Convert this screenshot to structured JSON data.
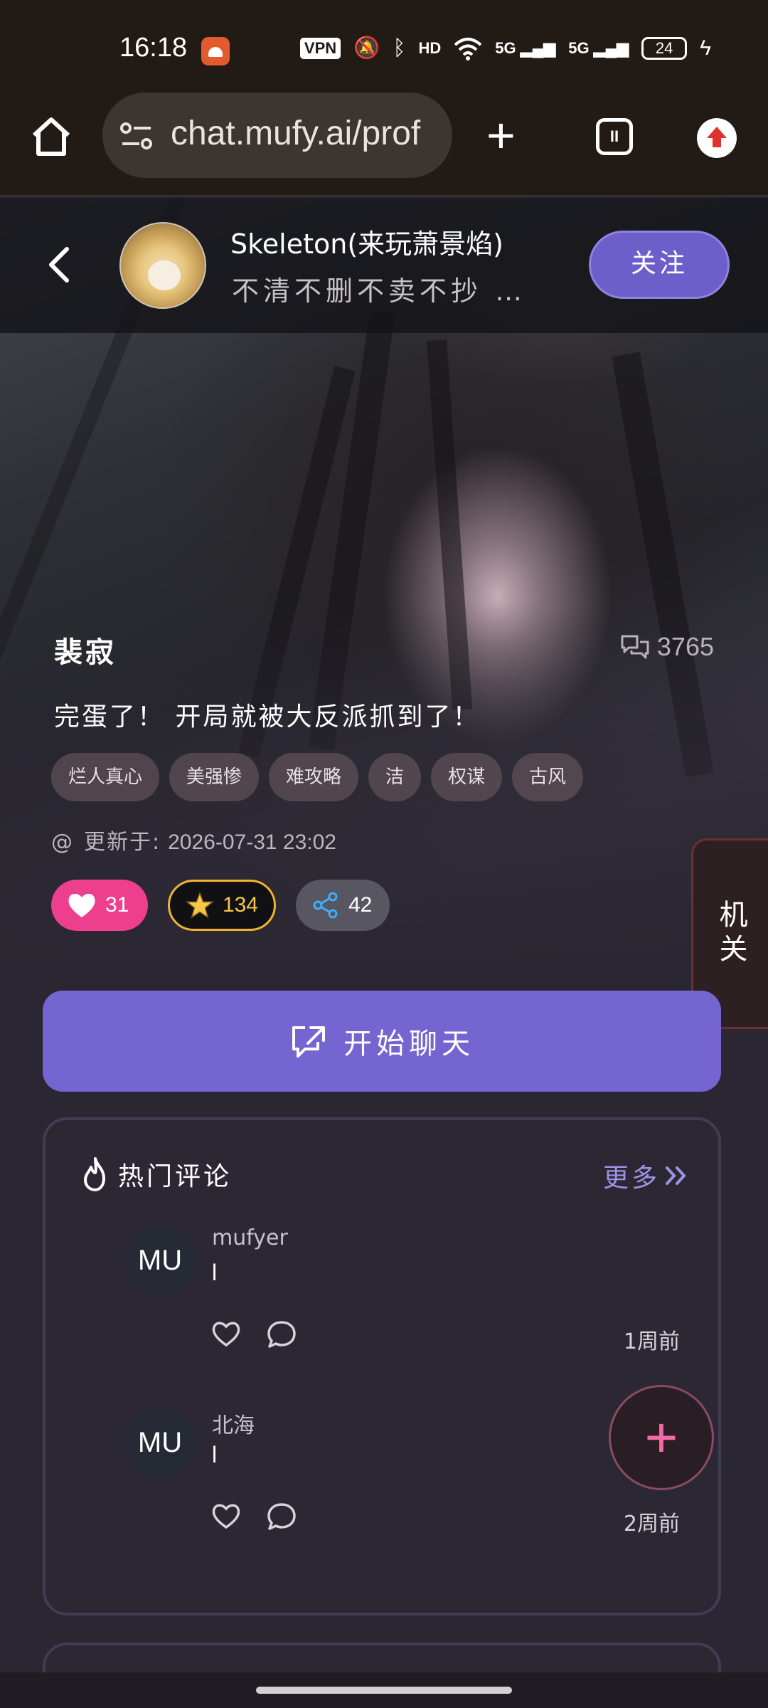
{
  "status_bar": {
    "time": "16:18",
    "vpn": "VPN",
    "hd": "HD",
    "net1": "5G",
    "net2": "5G",
    "battery": "24"
  },
  "browser": {
    "url": "chat.mufy.ai/prof",
    "tabs_count": "II"
  },
  "profile": {
    "creator_name": "Skeleton(来玩萧景焰)",
    "creator_bio": "不清不删不卖不抄 …",
    "follow_label": "关注"
  },
  "character": {
    "name": "裴寂",
    "chat_count": "3765",
    "tagline": "完蛋了！ 开局就被大反派抓到了！",
    "tags": [
      "烂人真心",
      "美强惨",
      "难攻略",
      "洁",
      "权谋",
      "古风"
    ],
    "updated_label": "更新于:",
    "updated_at": "2026-07-31 23:02",
    "likes": "31",
    "favorites": "134",
    "shares": "42"
  },
  "actions": {
    "start_chat": "开始聊天",
    "side_tab": "机关"
  },
  "comments": {
    "title": "热门评论",
    "more": "更多",
    "items": [
      {
        "avatar": "MU",
        "user": "mufyer",
        "text": "l",
        "time": "1周前"
      },
      {
        "avatar": "MU",
        "user": "北海",
        "text": "l",
        "time": "2周前"
      }
    ]
  },
  "fab": {
    "label": "+"
  },
  "colors": {
    "accent": "#7465d1",
    "follow": "#6d5fc9",
    "like": "#ee3f8e",
    "star": "#f2b332",
    "fab": "#f36aa9"
  }
}
